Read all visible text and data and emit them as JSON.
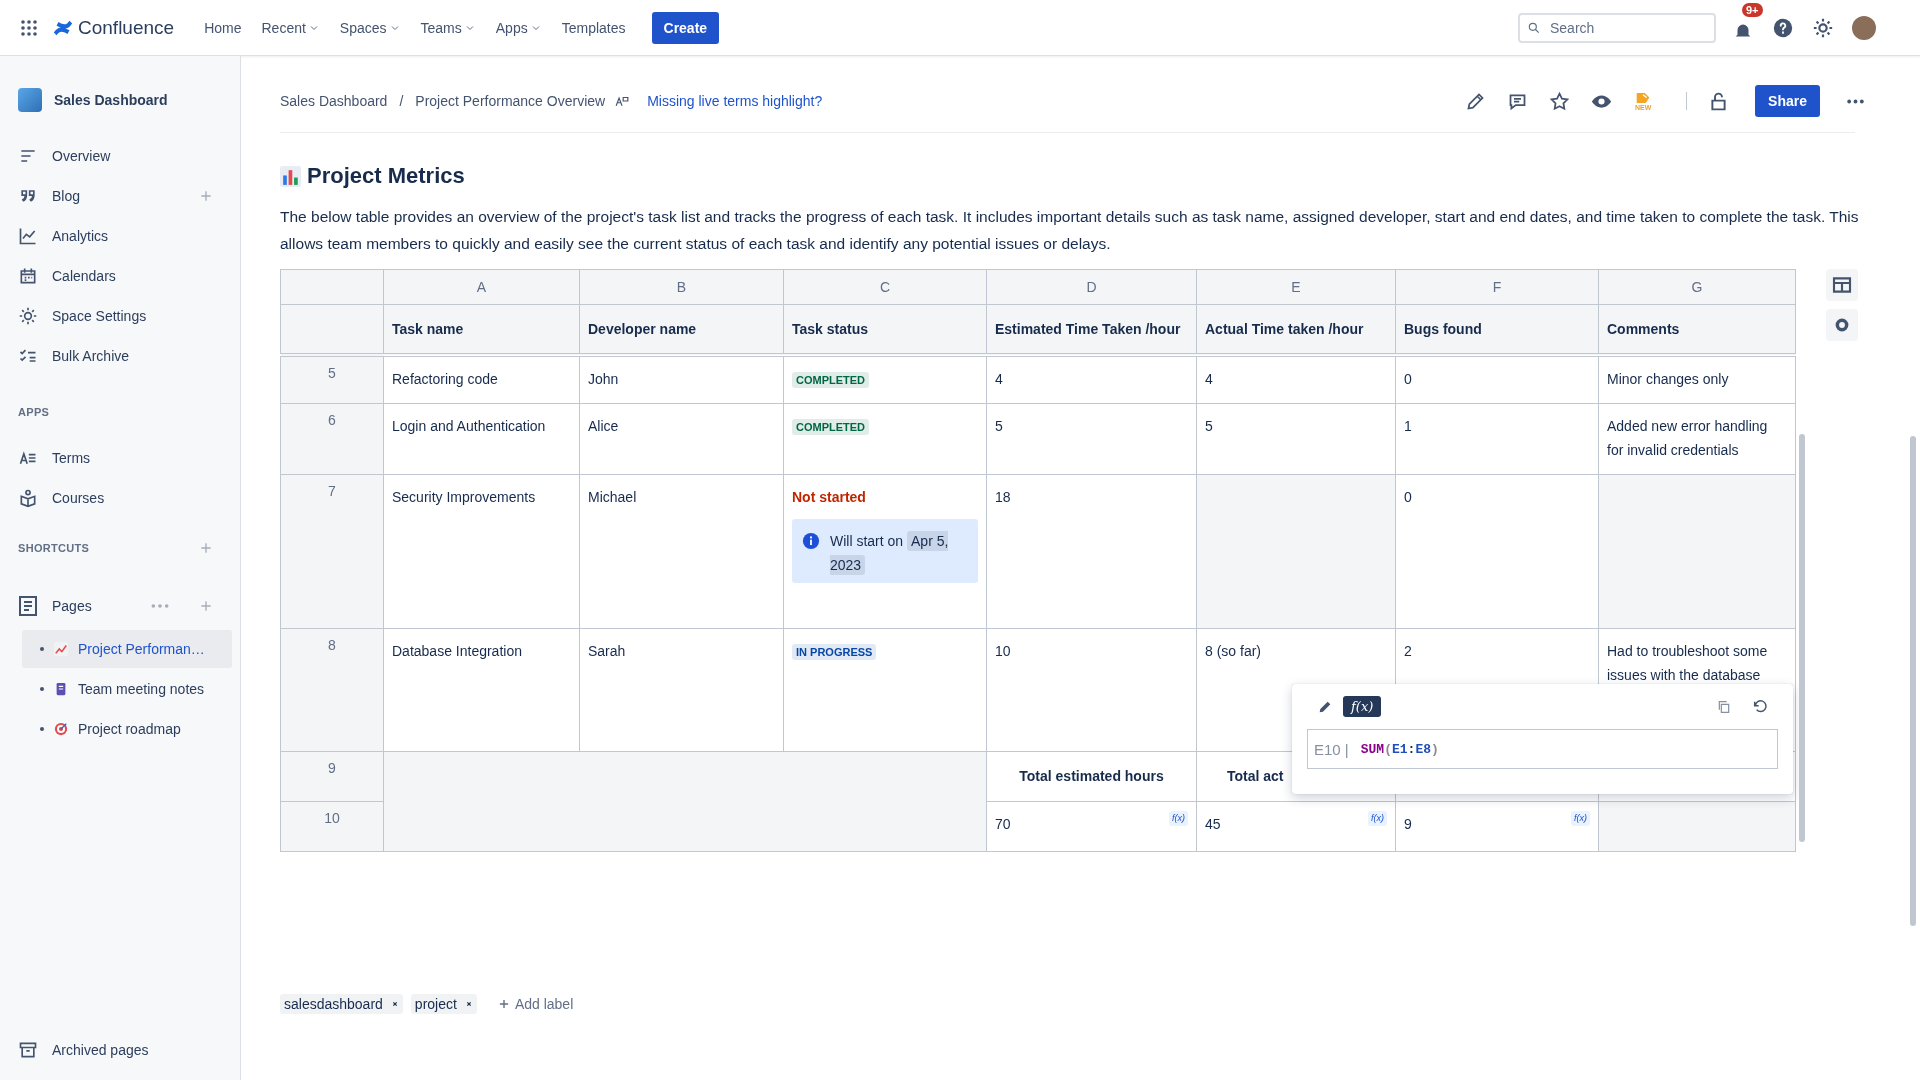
{
  "topbar": {
    "product": "Confluence",
    "nav": [
      {
        "label": "Home",
        "dropdown": false
      },
      {
        "label": "Recent",
        "dropdown": true
      },
      {
        "label": "Spaces",
        "dropdown": true
      },
      {
        "label": "Teams",
        "dropdown": true
      },
      {
        "label": "Apps",
        "dropdown": true
      },
      {
        "label": "Templates",
        "dropdown": false
      }
    ],
    "create": "Create",
    "search": {
      "placeholder": "Search"
    },
    "notifications": "9+"
  },
  "sidebar": {
    "space": "Sales Dashboard",
    "items": [
      {
        "label": "Overview",
        "add_button": false
      },
      {
        "label": "Blog",
        "add_button": true
      },
      {
        "label": "Analytics",
        "add_button": false
      },
      {
        "label": "Calendars",
        "add_button": false
      },
      {
        "label": "Space Settings",
        "add_button": false
      },
      {
        "label": "Bulk Archive",
        "add_button": false
      }
    ],
    "apps_heading": "APPS",
    "apps": [
      "Terms",
      "Courses"
    ],
    "shortcuts_heading": "SHORTCUTS",
    "pages": {
      "label": "Pages",
      "children": [
        {
          "label": "Project Performan…",
          "selected": true
        },
        {
          "label": "Team meeting notes",
          "selected": false
        },
        {
          "label": "Project roadmap",
          "selected": false
        }
      ]
    },
    "archived": "Archived pages"
  },
  "page": {
    "breadcrumbs": [
      "Sales Dashboard",
      "Project Performance Overview"
    ],
    "breadcrumb_separator": "/",
    "terms_link": "Missing live terms highlight?",
    "new_badge": "NEW",
    "share": "Share",
    "title": "Project Metrics",
    "description": "The below table provides an overview of the project's task list and tracks the progress of each task. It includes important details such as task name, assigned developer, start and end dates, and time taken to complete the task. This allows team members to quickly and easily see the current status of each task and identify any potential issues or delays.",
    "table": {
      "columns": [
        "A",
        "B",
        "C",
        "D",
        "E",
        "F",
        "G"
      ],
      "headers": [
        "Task name",
        "Developer name",
        "Task status",
        "Estimated Time Taken /hour",
        "Actual Time taken /hour",
        "Bugs found",
        "Comments"
      ],
      "rows": [
        {
          "number": "5",
          "task": "Refactoring code",
          "developer": "John",
          "status": {
            "kind": "lozenge",
            "label": "COMPLETED",
            "color": "#006644"
          },
          "estimated": "4",
          "actual": "4",
          "bugs": "0",
          "comment": "Minor changes only"
        },
        {
          "number": "6",
          "task": "Login and Authentication",
          "developer": "Alice",
          "status": {
            "kind": "lozenge",
            "label": "COMPLETED",
            "color": "#006644"
          },
          "estimated": "5",
          "actual": "5",
          "bugs": "1",
          "comment": "Added new error handling for invalid credentials"
        },
        {
          "number": "7",
          "task": "Security Improvements",
          "developer": "Michael",
          "status": {
            "kind": "text",
            "label": "Not started",
            "color": "#bf2600"
          },
          "note": {
            "text": "Will start on",
            "date": "Apr 5, 2023"
          },
          "estimated": "18",
          "bugs": "0"
        },
        {
          "number": "8",
          "task": "Database Integration",
          "developer": "Sarah",
          "status": {
            "kind": "lozenge",
            "label": "IN PROGRESS",
            "color": "#0747a6"
          },
          "estimated": "10",
          "actual": "8 (so far)",
          "bugs": "2",
          "comment": "Had to troubleshoot some issues with the database"
        }
      ],
      "totals": {
        "label_row": {
          "number": "9",
          "labels": [
            "Total estimated hours",
            "Total act"
          ]
        },
        "value_row": {
          "number": "10",
          "values": [
            {
              "value": "70",
              "badge": "f(x)"
            },
            {
              "value": "45",
              "badge": "f(x)"
            },
            {
              "value": "9",
              "badge": "f(x)"
            }
          ]
        }
      },
      "formula_popup": {
        "button": "f(x)",
        "cell": "E10",
        "separator": "|",
        "tokens": [
          {
            "text": "SUM",
            "kind": "function"
          },
          {
            "text": "(",
            "kind": "paren"
          },
          {
            "text": "E1",
            "kind": "ref"
          },
          {
            "text": ":",
            "kind": "operator"
          },
          {
            "text": "E8",
            "kind": "ref"
          },
          {
            "text": ")",
            "kind": "paren"
          }
        ]
      }
    },
    "labels": [
      "salesdashboard",
      "project"
    ],
    "add_label": "Add label"
  }
}
